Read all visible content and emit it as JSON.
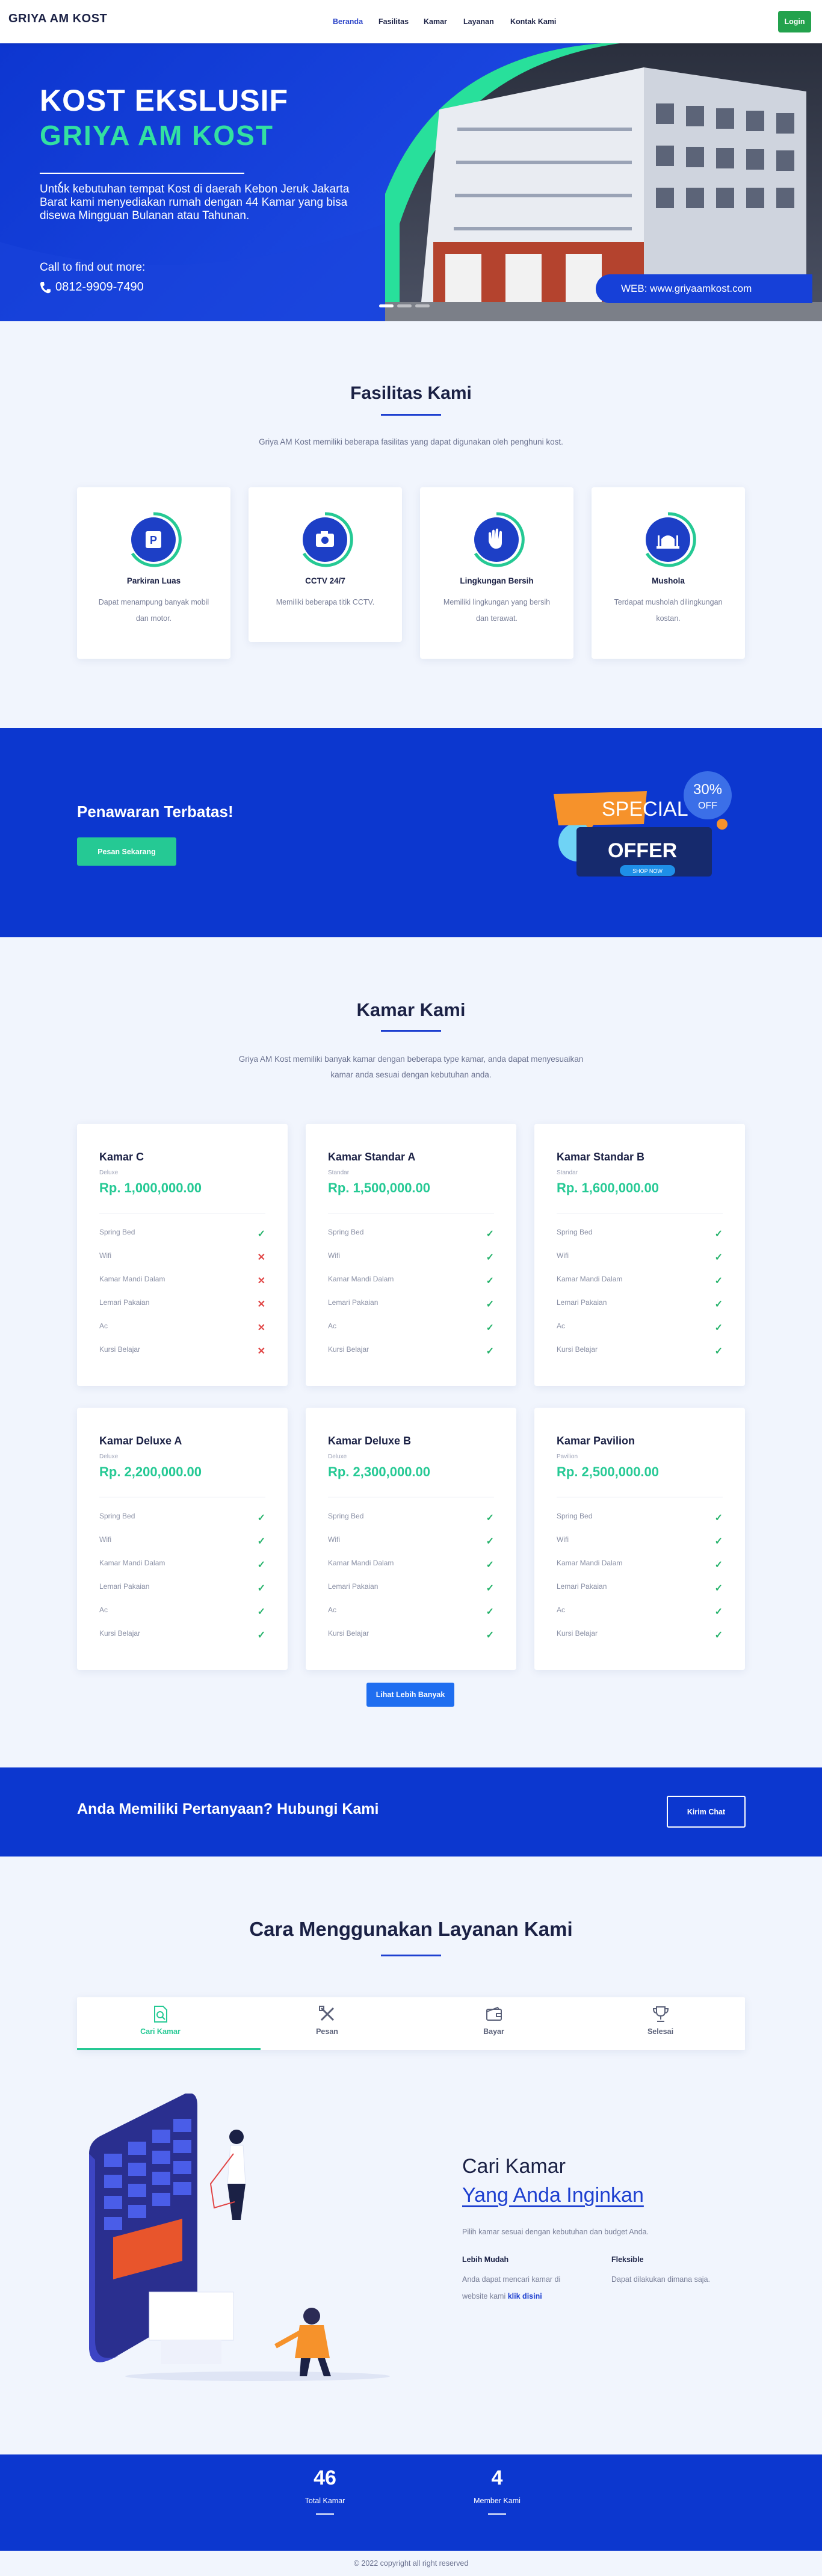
{
  "nav": {
    "brand": "GRIYA AM KOST",
    "links": [
      "Beranda",
      "Fasilitas",
      "Kamar",
      "Layanan",
      "Kontak Kami"
    ],
    "login": "Login"
  },
  "hero": {
    "title1": "KOST EKSLUSIF",
    "title2": "GRIYA AM KOST",
    "description": "Untuk kebutuhan tempat Kost di daerah Kebon Jeruk Jakarta Barat kami menyediakan rumah dengan 44 Kamar yang bisa disewa Mingguan Bulanan atau Tahunan.",
    "call_label": "Call to find out more:",
    "phone": "0812-9909-7490",
    "web": "WEB: www.griyaamkost.com"
  },
  "facilities": {
    "title": "Fasilitas Kami",
    "subtitle": "Griya AM Kost memiliki beberapa fasilitas yang dapat digunakan oleh penghuni kost.",
    "items": [
      {
        "title": "Parkiran Luas",
        "desc": "Dapat menampung banyak mobil dan motor.",
        "icon": "parking-icon"
      },
      {
        "title": "CCTV 24/7",
        "desc": "Memiliki beberapa titik CCTV.",
        "icon": "camera-icon"
      },
      {
        "title": "Lingkungan Bersih",
        "desc": "Memiliki lingkungan yang bersih dan terawat.",
        "icon": "clean-hand-icon"
      },
      {
        "title": "Mushola",
        "desc": "Terdapat musholah dilingkungan kostan.",
        "icon": "mosque-icon"
      }
    ]
  },
  "offer": {
    "title": "Penawaran Terbatas!",
    "button": "Pesan Sekarang",
    "badge_special": "SPECIAL",
    "badge_offer": "OFFER",
    "badge_pct": "30%",
    "badge_off": "OFF",
    "badge_shop": "SHOP NOW"
  },
  "rooms": {
    "title": "Kamar Kami",
    "subtitle_line1": "Griya AM Kost memiliki banyak kamar dengan beberapa type kamar, anda dapat menyesuaikan",
    "subtitle_line2": "kamar anda sesuai dengan kebutuhan anda.",
    "feature_names": [
      "Spring Bed",
      "Wifi",
      "Kamar Mandi Dalam",
      "Lemari Pakaian",
      "Ac",
      "Kursi Belajar"
    ],
    "items": [
      {
        "name": "Kamar C",
        "tier": "Deluxe",
        "price": "Rp. 1,000,000.00",
        "features": [
          true,
          false,
          false,
          false,
          false,
          false
        ]
      },
      {
        "name": "Kamar Standar A",
        "tier": "Standar",
        "price": "Rp. 1,500,000.00",
        "features": [
          true,
          true,
          true,
          true,
          true,
          true
        ]
      },
      {
        "name": "Kamar Standar B",
        "tier": "Standar",
        "price": "Rp. 1,600,000.00",
        "features": [
          true,
          true,
          true,
          true,
          true,
          true
        ]
      },
      {
        "name": "Kamar Deluxe A",
        "tier": "Deluxe",
        "price": "Rp. 2,200,000.00",
        "features": [
          true,
          true,
          true,
          true,
          true,
          true
        ]
      },
      {
        "name": "Kamar Deluxe B",
        "tier": "Deluxe",
        "price": "Rp. 2,300,000.00",
        "features": [
          true,
          true,
          true,
          true,
          true,
          true
        ]
      },
      {
        "name": "Kamar Pavilion",
        "tier": "Pavilion",
        "price": "Rp. 2,500,000.00",
        "features": [
          true,
          true,
          true,
          true,
          true,
          true
        ]
      }
    ],
    "more_button": "Lihat Lebih Banyak"
  },
  "contact": {
    "title": "Anda Memiliki Pertanyaan? Hubungi Kami",
    "button": "Kirim Chat"
  },
  "steps": {
    "title": "Cara Menggunakan Layanan Kami",
    "tabs": [
      "Cari Kamar",
      "Pesan",
      "Bayar",
      "Selesai"
    ],
    "active_tab": 0,
    "heading1": "Cari Kamar",
    "heading2": "Yang Anda Inginkan",
    "description": "Pilih kamar sesuai dengan kebutuhan dan budget Anda.",
    "col1_title": "Lebih Mudah",
    "col1_desc1": "Anda dapat mencari kamar di",
    "col1_desc2": "website kami",
    "col1_link": "klik disini",
    "col2_title": "Fleksible",
    "col2_desc": "Dapat dilakukan dimana saja."
  },
  "stats": [
    {
      "value": "46",
      "label": "Total Kamar"
    },
    {
      "value": "4",
      "label": "Member Kami"
    }
  ],
  "footer": "© 2022 copyright all right reserved",
  "colors": {
    "primary": "#0c37cf",
    "accent": "#25c994",
    "dark": "#1b2145",
    "login": "#23a24d"
  }
}
